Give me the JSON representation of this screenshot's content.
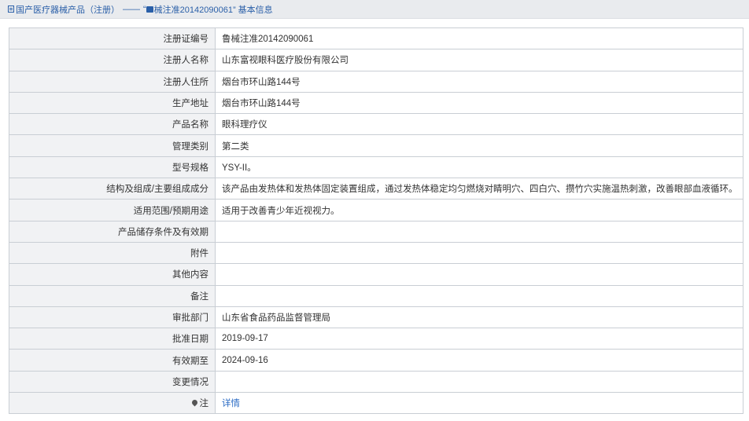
{
  "breadcrumb": {
    "section": "国产医疗器械产品（注册）",
    "separator": "——",
    "current_prefix": "“",
    "current_text": "械注准20142090061”",
    "suffix": "基本信息"
  },
  "rows": [
    {
      "key": "注册证编号",
      "value": "鲁械注准20142090061"
    },
    {
      "key": "注册人名称",
      "value": "山东富视眼科医疗股份有限公司"
    },
    {
      "key": "注册人住所",
      "value": "烟台市环山路144号"
    },
    {
      "key": "生产地址",
      "value": "烟台市环山路144号"
    },
    {
      "key": "产品名称",
      "value": "眼科理疗仪"
    },
    {
      "key": "管理类别",
      "value": "第二类"
    },
    {
      "key": "型号规格",
      "value": "YSY-II。"
    },
    {
      "key": "结构及组成/主要组成成分",
      "value": "该产品由发热体和发热体固定装置组成，通过发热体稳定均匀燃烧对睛明穴、四白穴、攒竹穴实施温热刺激，改善眼部血液循环。"
    },
    {
      "key": "适用范围/预期用途",
      "value": "适用于改善青少年近视视力。"
    },
    {
      "key": "产品储存条件及有效期",
      "value": ""
    },
    {
      "key": "附件",
      "value": ""
    },
    {
      "key": "其他内容",
      "value": ""
    },
    {
      "key": "备注",
      "value": ""
    },
    {
      "key": "审批部门",
      "value": "山东省食品药品监督管理局"
    },
    {
      "key": "批准日期",
      "value": "2019-09-17"
    },
    {
      "key": "有效期至",
      "value": "2024-09-16"
    },
    {
      "key": "变更情况",
      "value": ""
    }
  ],
  "note_row": {
    "key": "注",
    "link": "详情"
  }
}
